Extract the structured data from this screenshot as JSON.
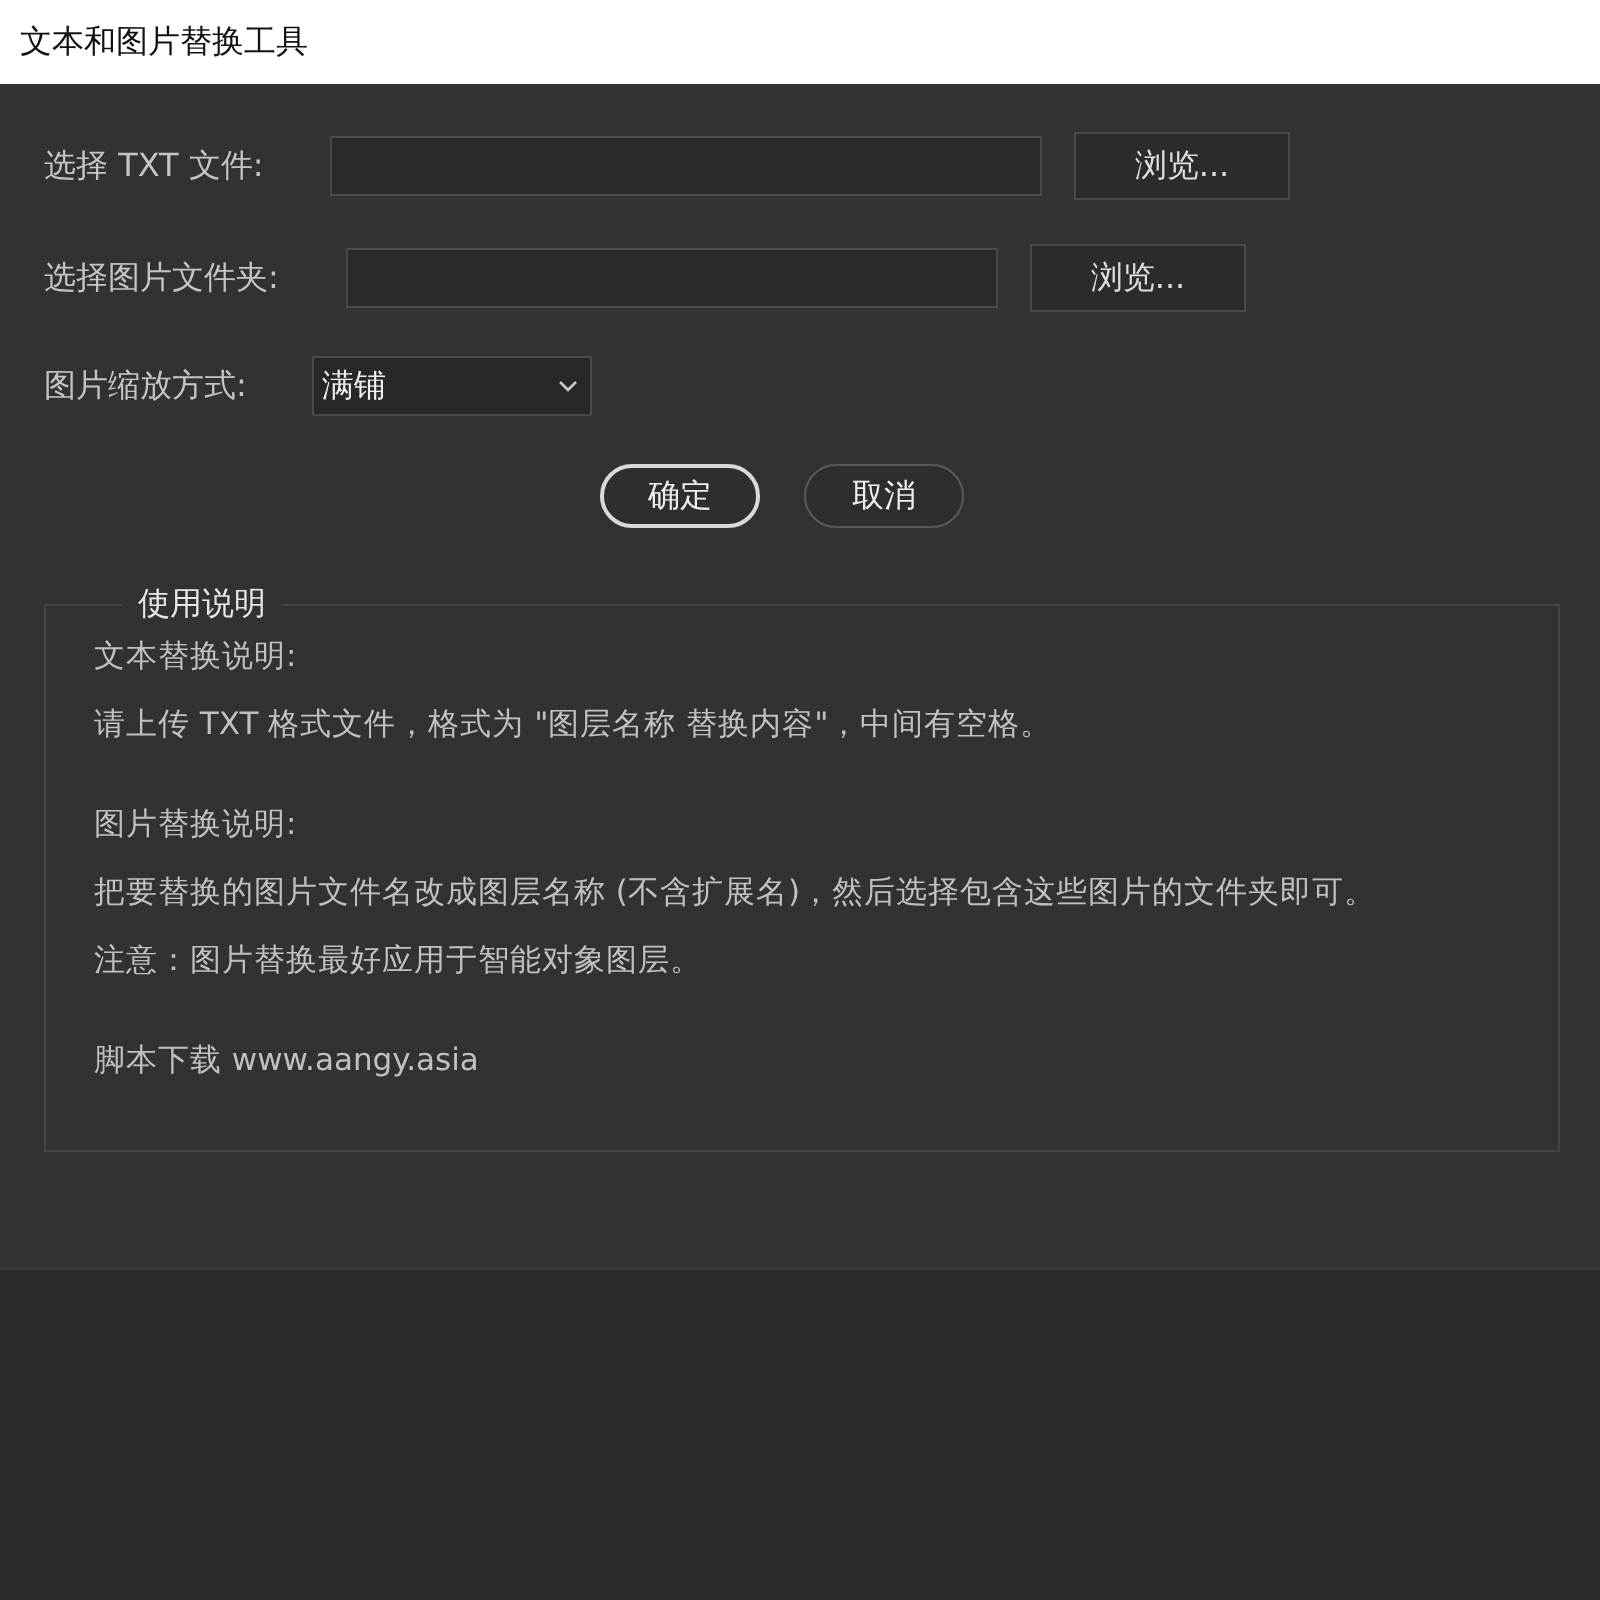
{
  "window": {
    "title": "文本和图片替换工具"
  },
  "file_rows": [
    {
      "label": "选择 TXT 文件:",
      "button": "浏览..."
    },
    {
      "label": "选择图片文件夹:",
      "button": "浏览..."
    }
  ],
  "scale": {
    "label": "图片缩放方式:",
    "value": "满铺"
  },
  "buttons": [
    {
      "label": "确定",
      "default": true
    },
    {
      "label": "取消",
      "default": false
    }
  ],
  "instructions": {
    "title": "使用说明",
    "groups": [
      [
        "文本替换说明:",
        "请上传 TXT 格式文件，格式为 \"图层名称 替换内容\"，中间有空格。"
      ],
      [
        "图片替换说明:",
        "把要替换的图片文件名改成图层名称 (不含扩展名)，然后选择包含这些图片的文件夹即可。",
        "注意：图片替换最好应用于智能对象图层。"
      ],
      [
        "脚本下载 www.aangy.asia"
      ]
    ]
  }
}
